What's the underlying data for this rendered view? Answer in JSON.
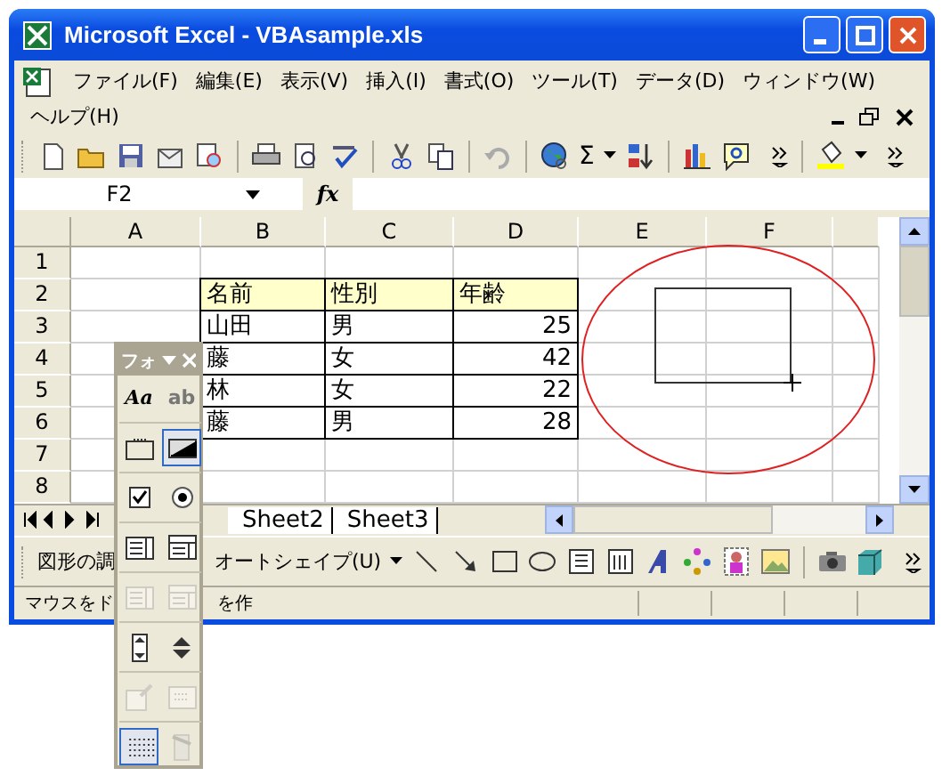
{
  "window": {
    "title": "Microsoft Excel - VBAsample.xls"
  },
  "menu": [
    {
      "label": "ファイル(F)"
    },
    {
      "label": "編集(E)"
    },
    {
      "label": "表示(V)"
    },
    {
      "label": "挿入(I)"
    },
    {
      "label": "書式(O)"
    },
    {
      "label": "ツール(T)"
    },
    {
      "label": "データ(D)"
    },
    {
      "label": "ウィンドウ(W)"
    },
    {
      "label": "ヘルプ(H)"
    }
  ],
  "toolbar": {
    "sum": "Σ"
  },
  "formula_bar": {
    "name_box": "F2",
    "fx": "fx"
  },
  "sheet": {
    "columns": [
      "A",
      "B",
      "C",
      "D",
      "E",
      "F"
    ],
    "rows": [
      {
        "number": "1"
      },
      {
        "number": "2",
        "highlighted": true,
        "cells": [
          "名前",
          "性別",
          "年齢"
        ]
      },
      {
        "number": "3",
        "highlighted": false,
        "cells": [
          "山田",
          "男",
          "25"
        ]
      },
      {
        "number": "4",
        "highlighted": false,
        "cells": [
          "藤",
          "女",
          "42"
        ]
      },
      {
        "number": "5",
        "highlighted": false,
        "cells": [
          "林",
          "女",
          "22"
        ]
      },
      {
        "number": "6",
        "highlighted": false,
        "cells": [
          "藤",
          "男",
          "28"
        ]
      },
      {
        "number": "7"
      },
      {
        "number": "8"
      }
    ]
  },
  "sheet_tabs": [
    {
      "label": "Sheet2"
    },
    {
      "label": "Sheet3"
    }
  ],
  "drawing_toolbar": {
    "draw_menu": "図形の調",
    "autoshape_menu": "オートシェイプ(U)"
  },
  "status_bar": [
    "マウスをド",
    "を作"
  ],
  "forms_toolbar": {
    "title": "フォ",
    "buttons": [
      {
        "kind": "label",
        "text": "Aa",
        "selected": false,
        "disabled": false
      },
      {
        "kind": "editbox",
        "text": "ab",
        "selected": false,
        "disabled": true
      },
      {
        "kind": "groupbox",
        "selected": false,
        "disabled": false
      },
      {
        "kind": "button",
        "selected": true,
        "disabled": false
      },
      {
        "kind": "checkbox",
        "selected": false,
        "disabled": false
      },
      {
        "kind": "option",
        "selected": false,
        "disabled": false
      },
      {
        "kind": "listbox",
        "selected": false,
        "disabled": false
      },
      {
        "kind": "combobox",
        "selected": false,
        "disabled": false
      },
      {
        "kind": "combolist",
        "selected": false,
        "disabled": true
      },
      {
        "kind": "combodrop",
        "selected": false,
        "disabled": true
      },
      {
        "kind": "scrollbar",
        "selected": false,
        "disabled": false
      },
      {
        "kind": "spinner",
        "selected": false,
        "disabled": false
      },
      {
        "kind": "properties",
        "selected": false,
        "disabled": true
      },
      {
        "kind": "code",
        "selected": false,
        "disabled": true
      },
      {
        "kind": "grid",
        "selected": true,
        "disabled": false
      },
      {
        "kind": "dialog",
        "selected": false,
        "disabled": true
      }
    ]
  }
}
